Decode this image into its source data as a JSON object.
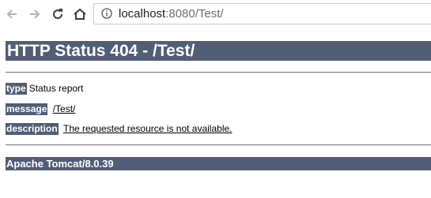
{
  "browser": {
    "url_host": "localhost",
    "url_rest": ":8080/Test/",
    "icons": {
      "back": "arrow-left-icon",
      "forward": "arrow-right-icon",
      "reload": "reload-icon",
      "home": "home-icon",
      "site_info": "info-circle-icon"
    }
  },
  "page": {
    "title": "HTTP Status 404 - /Test/",
    "rows": [
      {
        "label": "type",
        "value": "Status report"
      },
      {
        "label": "message",
        "value": "/Test/"
      },
      {
        "label": "description",
        "value": "The requested resource is not available."
      }
    ],
    "footer": "Apache Tomcat/8.0.39"
  },
  "colors": {
    "header_bg": "#525d76",
    "header_text": "#ffffff"
  }
}
